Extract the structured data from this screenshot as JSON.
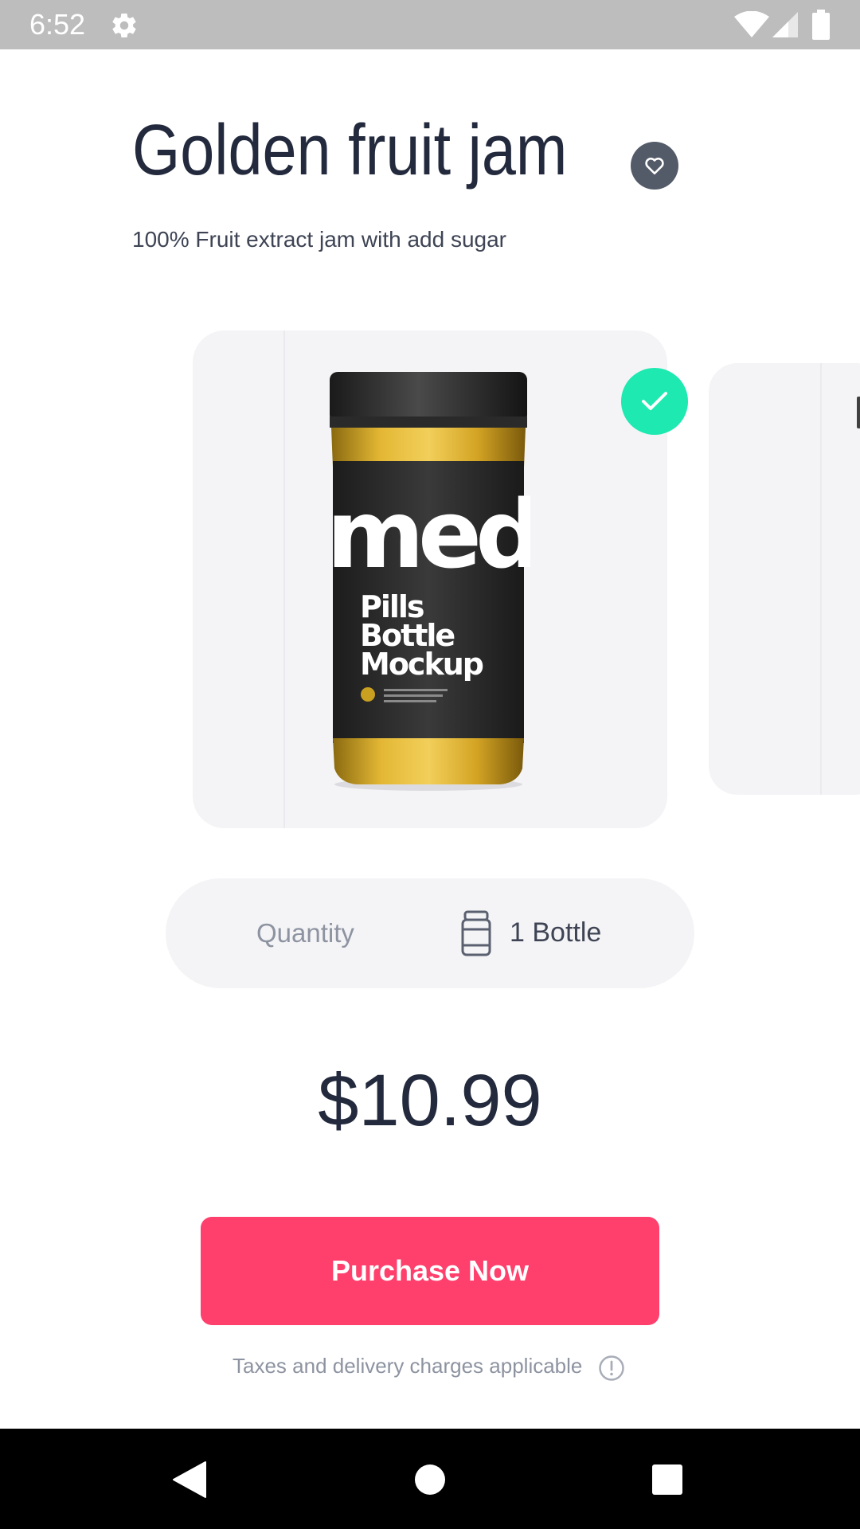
{
  "status_bar": {
    "time": "6:52",
    "icons": [
      "gear-icon",
      "wifi-icon",
      "signal-icon",
      "battery-icon"
    ]
  },
  "product": {
    "title": "Golden fruit jam",
    "subtitle": "100% Fruit extract jam with add sugar",
    "favorite_icon": "heart-outline-icon",
    "jar_label": {
      "brand": "med",
      "line1": "Pills",
      "line2": "Bottle",
      "line3": "Mockup"
    },
    "selected_icon": "check-icon"
  },
  "quantity": {
    "label": "Quantity",
    "icon": "bottle-icon",
    "value": "1 Bottle"
  },
  "price": "$10.99",
  "purchase": {
    "button_label": "Purchase Now",
    "note": "Taxes and delivery charges applicable",
    "note_icon": "info-icon"
  },
  "nav_bar": {
    "icons": [
      "back-icon",
      "home-icon",
      "recents-icon"
    ]
  },
  "colors": {
    "status_bar": "#bdbdbd",
    "title": "#232a3d",
    "accent": "#ff3f6c",
    "selected": "#1de9b0",
    "card_bg": "#f4f4f6",
    "favorite_bg": "#535a68",
    "muted_text": "#8d93a0"
  }
}
